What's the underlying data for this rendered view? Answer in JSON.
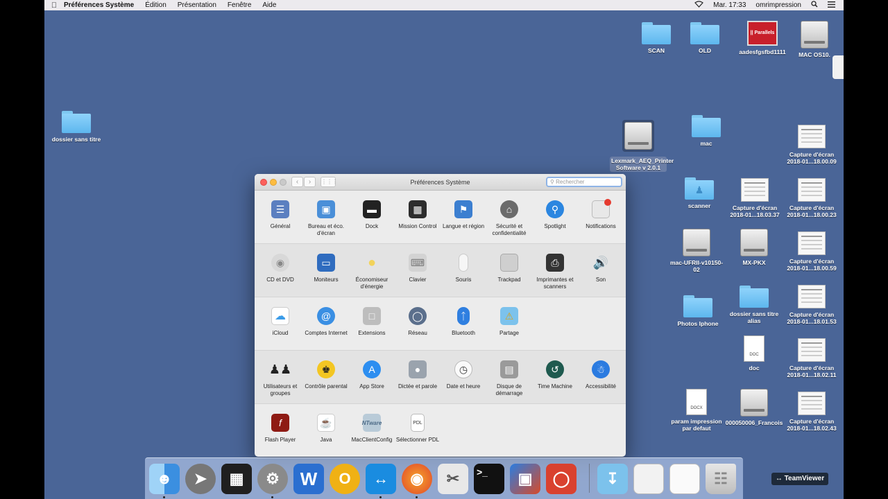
{
  "menubar": {
    "app_name": "Préférences Système",
    "menus": [
      "Édition",
      "Présentation",
      "Fenêtre",
      "Aide"
    ],
    "clock": "Mar. 17:33",
    "user": "omrimpression"
  },
  "desktop": {
    "icons": {
      "scan": "SCAN",
      "old": "OLD",
      "parallels": "aadesfgsfbd1111",
      "macos": "MAC OS10.",
      "dossier_sans_titre": "dossier sans titre",
      "lexmark": "Lexmark_AEQ_Printer Software v 2.0.1",
      "mac": "mac",
      "capture1": "Capture d'écran 2018-01...18.00.09",
      "scanner": "scanner",
      "capture2": "Capture d'écran 2018-01...18.03.37",
      "capture3": "Capture d'écran 2018-01...18.00.23",
      "mac_ufrii": "mac-UFRII-v10150-02",
      "mx_pkx": "MX-PKX",
      "capture4": "Capture d'écran 2018-01...18.00.59",
      "photos_iphone": "Photos Iphone",
      "dossier_alias": "dossier sans titre alias",
      "capture5": "Capture d'écran 2018-01...18.01.53",
      "doc": "doc",
      "capture6": "Capture d'écran 2018-01...18.02.11",
      "param": "param impression par defaut",
      "francois": "000050006_Francois",
      "capture7": "Capture d'écran 2018-01...18.02.43",
      "parallels_logo": "|| Parallels",
      "doc_badge": "DOC",
      "docx_badge": "DOCX"
    }
  },
  "prefs_window": {
    "title": "Préférences Système",
    "search_placeholder": "Rechercher",
    "rows": [
      [
        "Général",
        "Bureau et éco. d'écran",
        "Dock",
        "Mission Control",
        "Langue et région",
        "Sécurité et confidentialité",
        "Spotlight",
        "Notifications"
      ],
      [
        "CD et DVD",
        "Moniteurs",
        "Économiseur d'énergie",
        "Clavier",
        "Souris",
        "Trackpad",
        "Imprimantes et scanners",
        "Son"
      ],
      [
        "iCloud",
        "Comptes Internet",
        "Extensions",
        "Réseau",
        "Bluetooth",
        "Partage"
      ],
      [
        "Utilisateurs et groupes",
        "Contrôle parental",
        "App Store",
        "Dictée et parole",
        "Date et heure",
        "Disque de démarrage",
        "Time Machine",
        "Accessibilité"
      ],
      [
        "Flash Player",
        "Java",
        "MacClientConfig",
        "Sélectionner PDL"
      ]
    ]
  },
  "teamviewer": "TeamViewer"
}
